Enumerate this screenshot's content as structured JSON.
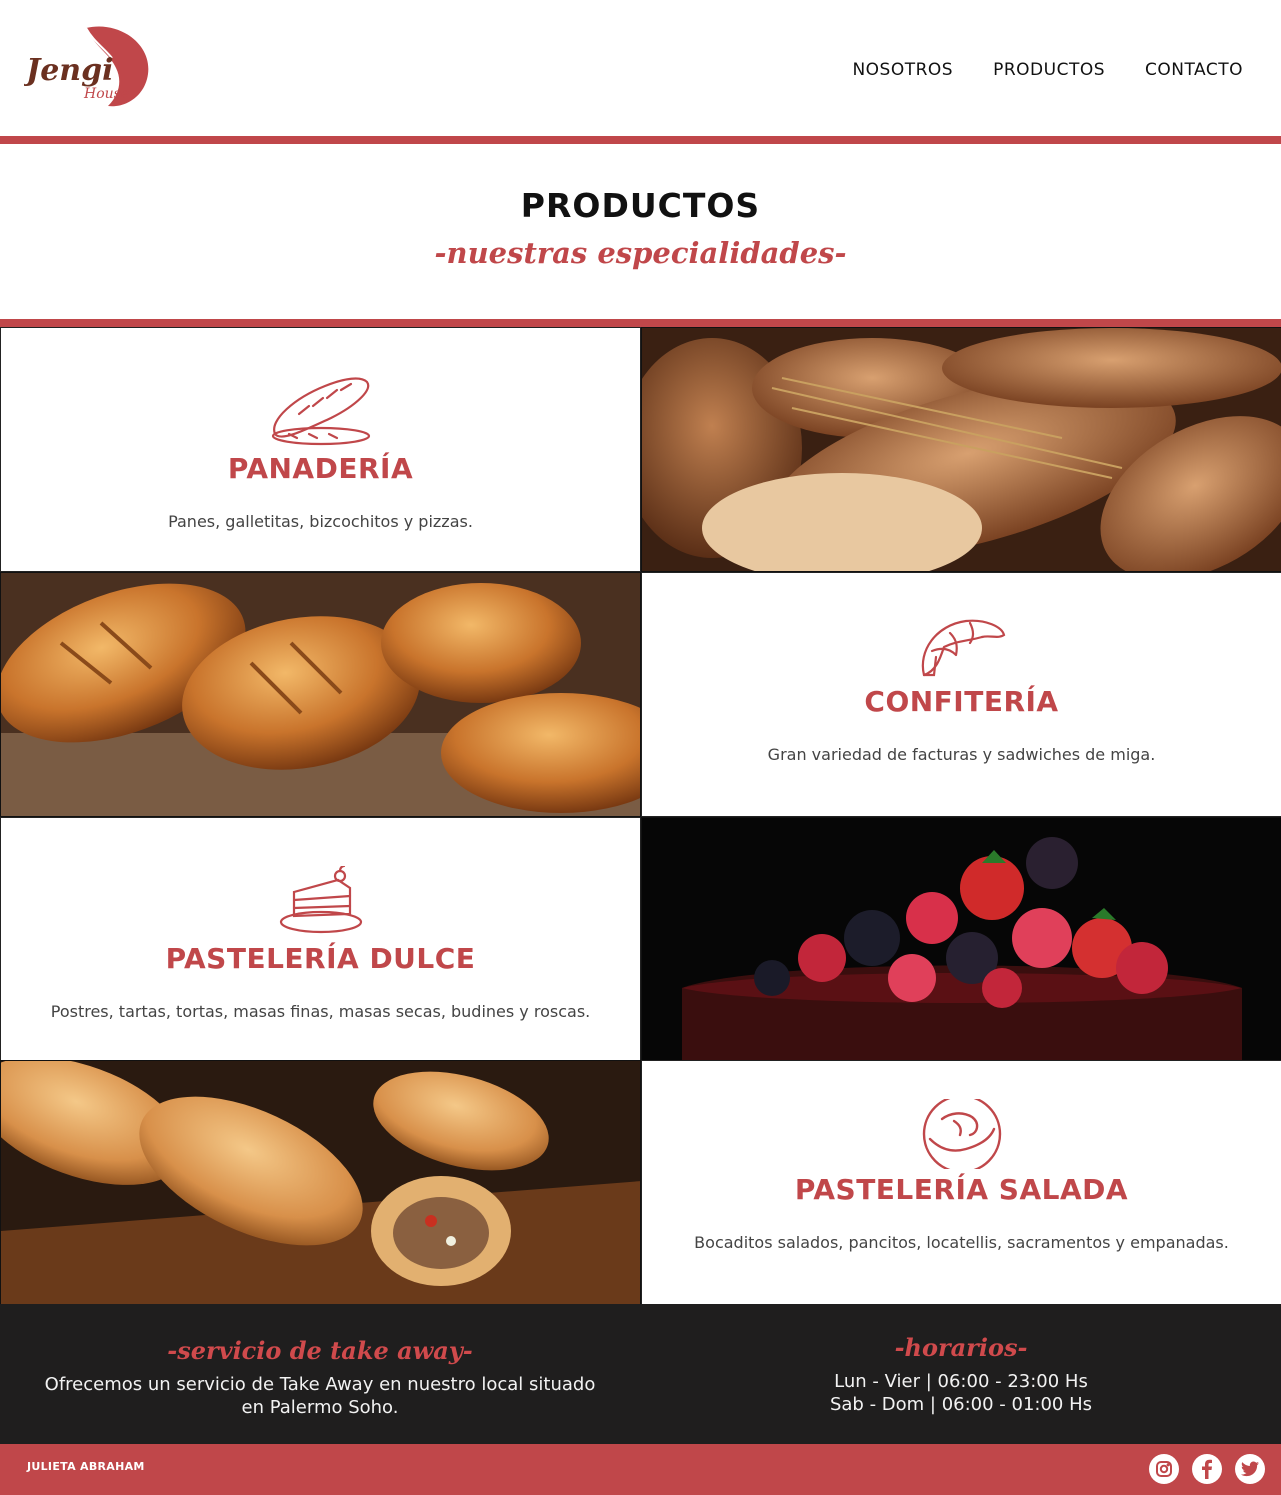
{
  "brand": {
    "logo_text": "Jengi",
    "logo_sub": "House"
  },
  "nav": {
    "items": [
      "NOSOTROS",
      "PRODUCTOS",
      "CONTACTO"
    ]
  },
  "page": {
    "title": "PRODUCTOS",
    "subtitle": "-nuestras especialidades-"
  },
  "categories": [
    {
      "title": "PANADERÍA",
      "description": "Panes, galletitas, bizcochitos y pizzas.",
      "icon": "bread-icon"
    },
    {
      "title": "CONFITERÍA",
      "description": "Gran variedad de facturas y sadwiches de miga.",
      "icon": "croissant-icon"
    },
    {
      "title": "PASTELERÍA DULCE",
      "description": "Postres, tartas, tortas, masas finas, masas secas, budines y roscas.",
      "icon": "cake-icon"
    },
    {
      "title": "PASTELERÍA SALADA",
      "description": "Bocaditos salados, pancitos, locatellis, sacramentos y empanadas.",
      "icon": "bun-icon"
    }
  ],
  "takeaway": {
    "title": "-servicio de take away-",
    "text": "Ofrecemos un servicio de Take Away en nuestro local situado en Palermo Soho."
  },
  "hours": {
    "title": "-horarios-",
    "weekday": "Lun - Vier | 06:00 - 23:00 Hs",
    "weekend": "Sab - Dom | 06:00 - 01:00 Hs"
  },
  "footer": {
    "author": "JULIETA ABRAHAM",
    "socials": [
      "instagram-icon",
      "facebook-icon",
      "twitter-icon"
    ]
  },
  "colors": {
    "accent": "#c0474a",
    "dark": "#1f1e1e",
    "white": "#ffffff"
  }
}
